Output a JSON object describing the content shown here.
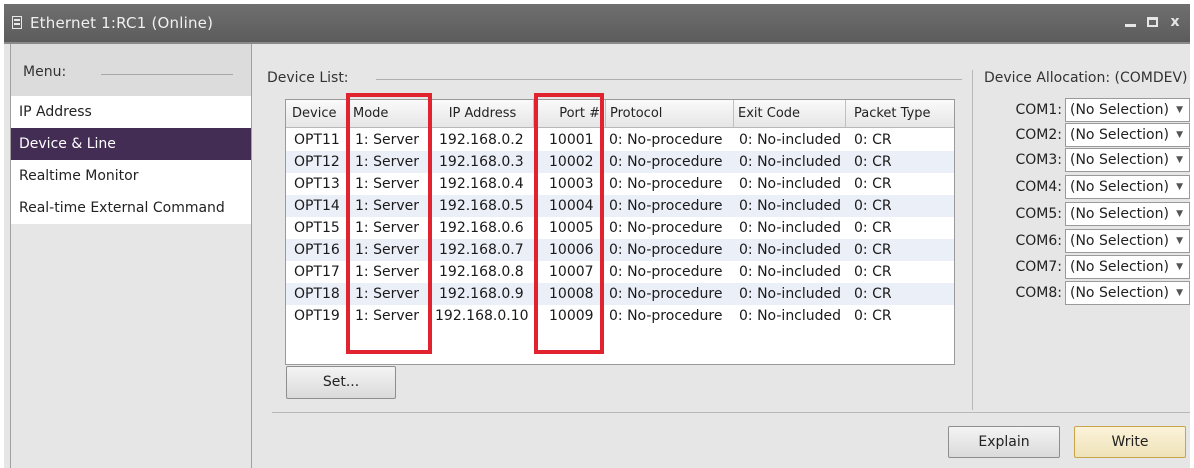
{
  "window": {
    "title": "Ethernet 1:RC1  (Online)",
    "icons": {
      "window": "document-icon",
      "minimize": "minimize-icon",
      "maximize": "maximize-icon",
      "close": "close-icon"
    },
    "close_glyph": "x"
  },
  "menu": {
    "label": "Menu:",
    "items": [
      {
        "label": "IP Address",
        "selected": false
      },
      {
        "label": "Device & Line",
        "selected": true
      },
      {
        "label": "Realtime Monitor",
        "selected": false
      },
      {
        "label": "Real-time External Command",
        "selected": false
      }
    ]
  },
  "device_list": {
    "label": "Device List:",
    "columns": [
      "Device",
      "Mode",
      "IP Address",
      "Port #",
      "Protocol",
      "Exit Code",
      "Packet Type"
    ],
    "rows": [
      [
        "OPT11",
        "1: Server",
        "192.168.0.2",
        "10001",
        "0: No-procedure",
        "0: No-included",
        "0: CR"
      ],
      [
        "OPT12",
        "1: Server",
        "192.168.0.3",
        "10002",
        "0: No-procedure",
        "0: No-included",
        "0: CR"
      ],
      [
        "OPT13",
        "1: Server",
        "192.168.0.4",
        "10003",
        "0: No-procedure",
        "0: No-included",
        "0: CR"
      ],
      [
        "OPT14",
        "1: Server",
        "192.168.0.5",
        "10004",
        "0: No-procedure",
        "0: No-included",
        "0: CR"
      ],
      [
        "OPT15",
        "1: Server",
        "192.168.0.6",
        "10005",
        "0: No-procedure",
        "0: No-included",
        "0: CR"
      ],
      [
        "OPT16",
        "1: Server",
        "192.168.0.7",
        "10006",
        "0: No-procedure",
        "0: No-included",
        "0: CR"
      ],
      [
        "OPT17",
        "1: Server",
        "192.168.0.8",
        "10007",
        "0: No-procedure",
        "0: No-included",
        "0: CR"
      ],
      [
        "OPT18",
        "1: Server",
        "192.168.0.9",
        "10008",
        "0: No-procedure",
        "0: No-included",
        "0: CR"
      ],
      [
        "OPT19",
        "1: Server",
        "192.168.0.10",
        "10009",
        "0: No-procedure",
        "0: No-included",
        "0: CR"
      ]
    ],
    "set_button": "Set..."
  },
  "allocation": {
    "label": "Device Allocation: (COMDEV)",
    "ports": [
      {
        "name": "COM1:",
        "value": "(No Selection)"
      },
      {
        "name": "COM2:",
        "value": "(No Selection)"
      },
      {
        "name": "COM3:",
        "value": "(No Selection)"
      },
      {
        "name": "COM4:",
        "value": "(No Selection)"
      },
      {
        "name": "COM5:",
        "value": "(No Selection)"
      },
      {
        "name": "COM6:",
        "value": "(No Selection)"
      },
      {
        "name": "COM7:",
        "value": "(No Selection)"
      },
      {
        "name": "COM8:",
        "value": "(No Selection)"
      }
    ],
    "dropdown_icon": "dropdown-arrow-icon"
  },
  "footer": {
    "explain_button": "Explain",
    "write_button": "Write"
  },
  "colors": {
    "titlebar": "#5f5f5f",
    "selected_menu": "#432d55",
    "highlight_box": "#e0232f",
    "alt_row": "#ebeff8",
    "write_button": "#f3e8c4"
  }
}
